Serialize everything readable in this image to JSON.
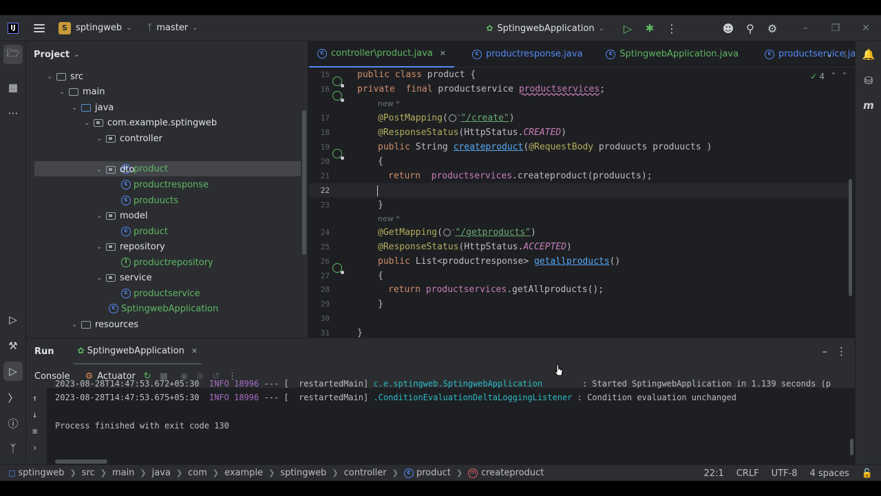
{
  "titlebar": {
    "logo": "IJ",
    "project_initial": "S",
    "project_name": "sptingweb",
    "branch": "master",
    "run_config": "SptingwebApplication"
  },
  "project_panel": {
    "title": "Project",
    "tree": [
      {
        "label": "src",
        "type": "folder"
      },
      {
        "label": "main",
        "type": "folder"
      },
      {
        "label": "java",
        "type": "folder-blue"
      },
      {
        "label": "com.example.sptingweb",
        "type": "package"
      },
      {
        "label": "controller",
        "type": "package"
      },
      {
        "label": "product",
        "type": "class"
      },
      {
        "label": "dto",
        "type": "package"
      },
      {
        "label": "productresponse",
        "type": "class"
      },
      {
        "label": "produucts",
        "type": "class"
      },
      {
        "label": "model",
        "type": "package"
      },
      {
        "label": "product",
        "type": "class"
      },
      {
        "label": "repository",
        "type": "package"
      },
      {
        "label": "productrepository",
        "type": "interface"
      },
      {
        "label": "service",
        "type": "package"
      },
      {
        "label": "productservice",
        "type": "class"
      },
      {
        "label": "SptingwebApplication",
        "type": "class"
      },
      {
        "label": "resources",
        "type": "folder"
      }
    ]
  },
  "editor": {
    "tabs": [
      {
        "label": "controller\\product.java",
        "active": true
      },
      {
        "label": "productresponse.java",
        "active": false
      },
      {
        "label": "SptingwebApplication.java",
        "active": false
      },
      {
        "label": "productservice.jav",
        "active": false
      }
    ],
    "inspection_count": "4",
    "usage_hint": "new *",
    "line_numbers": [
      "15",
      "16",
      "17",
      "18",
      "19",
      "20",
      "21",
      "22",
      "23",
      "24",
      "25",
      "26",
      "27",
      "28",
      "29",
      "30",
      "31"
    ],
    "code": {
      "l15_kw": "public class ",
      "l15_rest": "product {",
      "l16_kw": "private  final ",
      "l16_type": "productservice ",
      "l16_field": "productservices",
      "l16_end": ";",
      "l17_ann": "@PostMapping",
      "l17_open": "(",
      "l17_str": "\"/create\"",
      "l17_close": ")",
      "l18_ann": "@ResponseStatus",
      "l18_open": "(HttpStatus.",
      "l18_const": "CREATED",
      "l18_close": ")",
      "l19_kw": "public ",
      "l19_type": "String ",
      "l19_fn": "createproduct",
      "l19_open": "(",
      "l19_ann": "@RequestBody ",
      "l19_rest": "produucts produucts )",
      "l20": "{",
      "l21_kw": "return  ",
      "l21_field": "productservices",
      "l21_rest": ".createproduct(produucts);",
      "l23": "}",
      "l24_ann": "@GetMapping",
      "l24_open": "(",
      "l24_str": "\"/getproducts\"",
      "l24_close": ")",
      "l25_ann": "@ResponseStatus",
      "l25_open": "(HttpStatus.",
      "l25_const": "ACCEPTED",
      "l25_close": ")",
      "l26_kw": "public ",
      "l26_type": "List<productresponse> ",
      "l26_fn": "getallproducts",
      "l26_rest": "()",
      "l27": "{",
      "l28_kw": "return ",
      "l28_field": "productservices",
      "l28_rest": ".getAllproducts();",
      "l29": "}",
      "l31": "}"
    }
  },
  "run_panel": {
    "title": "Run",
    "tab": "SptingwebApplication",
    "console_label": "Console",
    "actuator_label": "Actuator",
    "logs": [
      {
        "ts": "2023-08-28T14:47:53.672+05:30",
        "level": "INFO",
        "pid": "18996",
        "sep": " --- [",
        "thread": "  restartedMain]",
        "logger": " c.e.sptingweb.SptingwebApplication       ",
        "msg": " : Started SptingwebApplication in 1.139 seconds (p"
      },
      {
        "ts": "2023-08-28T14:47:53.675+05:30",
        "level": "INFO",
        "pid": "18996",
        "sep": " --- [",
        "thread": "  restartedMain]",
        "logger": " .ConditionEvaluationDeltaLoggingListener",
        "msg": " : Condition evaluation unchanged"
      }
    ],
    "exit_message": "Process finished with exit code 130"
  },
  "statusbar": {
    "breadcrumbs": [
      "sptingweb",
      "src",
      "main",
      "java",
      "com",
      "example",
      "sptingweb",
      "controller",
      "product",
      "createproduct"
    ],
    "position": "22:1",
    "line_sep": "CRLF",
    "encoding": "UTF-8",
    "indent": "4 spaces"
  }
}
